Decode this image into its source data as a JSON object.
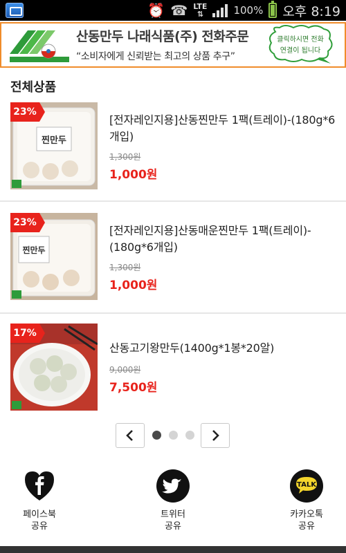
{
  "status_bar": {
    "network": "LTE",
    "battery": "100%",
    "battery_level": 1.0,
    "time": "오후 8:19"
  },
  "banner": {
    "title": "산동만두 나래식품(주) 전화주문",
    "subtitle": "“소비자에게 신뢰받는 최고의 상품 추구”",
    "bubble_line1": "클릭하시면 전화",
    "bubble_line2": "연결이 됩니다"
  },
  "section_title": "전체상품",
  "products": [
    {
      "discount": "23%",
      "name": "[전자레인지용]산동찐만두 1팩(트레이)-(180g*6개입)",
      "original_price": "1,300원",
      "price": "1,000원",
      "package_label": "찐만두"
    },
    {
      "discount": "23%",
      "name": "[전자레인지용]산동매운찐만두 1팩(트레이)-(180g*6개입)",
      "original_price": "1,300원",
      "price": "1,000원",
      "package_label": "찐만두"
    },
    {
      "discount": "17%",
      "name": "산동고기왕만두(1400g*1봉*20알)",
      "original_price": "9,000원",
      "price": "7,500원",
      "package_label": ""
    }
  ],
  "pager": {
    "prev_icon": "chevron-left-icon",
    "next_icon": "chevron-right-icon",
    "pages": 3,
    "current_page": 1
  },
  "share": [
    {
      "icon": "facebook-icon",
      "label_line1": "페이스북",
      "label_line2": "공유"
    },
    {
      "icon": "twitter-icon",
      "label_line1": "트위터",
      "label_line2": "공유"
    },
    {
      "icon": "kakaotalk-icon",
      "label_line1": "카카오톡",
      "label_line2": "공유",
      "icon_text": "TALK"
    }
  ],
  "colors": {
    "accent_red": "#e8231c",
    "banner_border": "#f08c2a",
    "battery_green": "#8bc34a"
  }
}
